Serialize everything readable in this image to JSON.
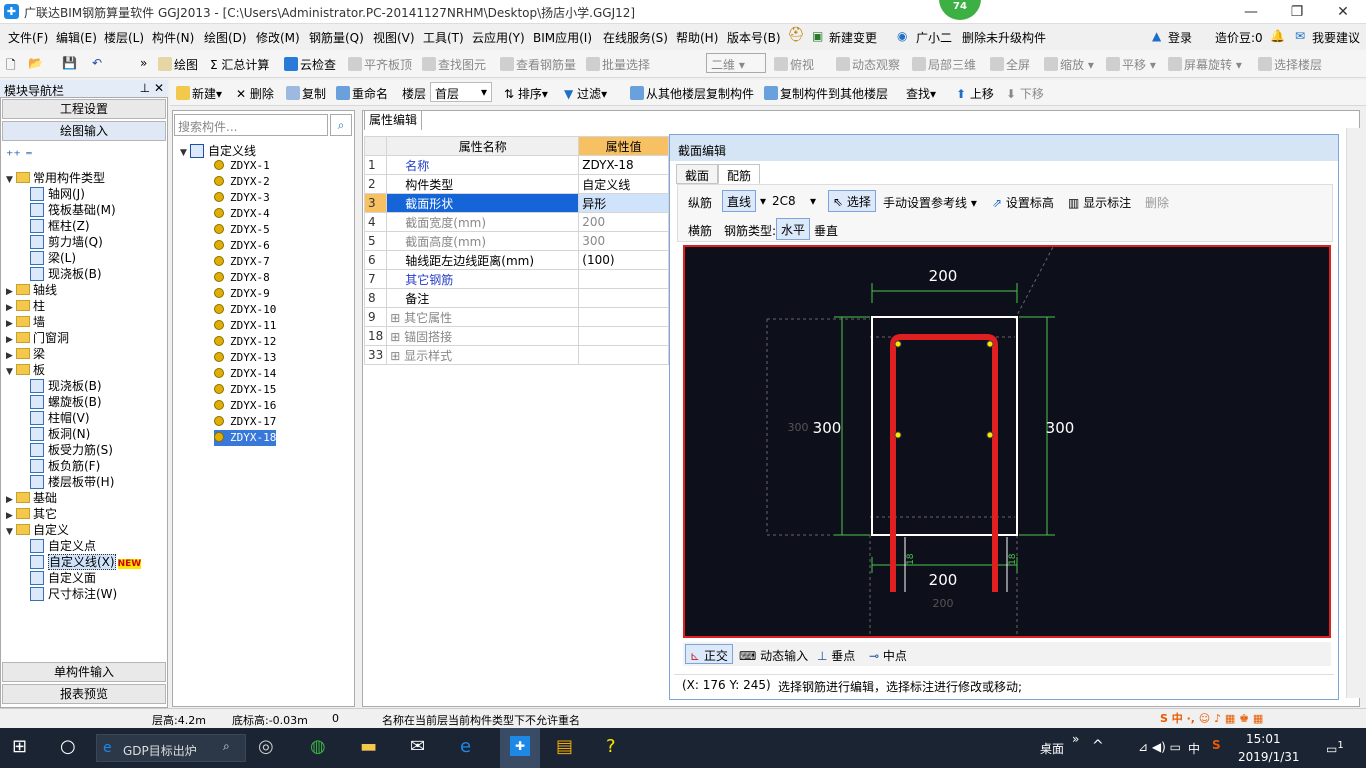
{
  "app": {
    "title": "广联达BIM钢筋算量软件 GGJ2013 - [C:\\Users\\Administrator.PC-20141127NRHM\\Desktop\\扬店小学.GGJ12]",
    "badge": "74",
    "win_min": "—",
    "win_max": "❐",
    "win_close": "✕"
  },
  "menu": [
    "文件(F)",
    "编辑(E)",
    "楼层(L)",
    "构件(N)",
    "绘图(D)",
    "修改(M)",
    "钢筋量(Q)",
    "视图(V)",
    "工具(T)",
    "云应用(Y)",
    "BIM应用(I)",
    "在线服务(S)",
    "帮助(H)",
    "版本号(B)",
    "新建变更",
    "广小二",
    "删除未升级构件"
  ],
  "menu_right": {
    "login": "登录",
    "price": "造价豆:0",
    "suggest": "我要建议"
  },
  "toolbar1": [
    "绘图",
    "Σ 汇总计算",
    "云检查",
    "平齐板顶",
    "查找图元",
    "查看钢筋量",
    "批量选择",
    "二维",
    "俯视",
    "动态观察",
    "局部三维",
    "全屏",
    "缩放",
    "平移",
    "屏幕旋转",
    "选择楼层"
  ],
  "toolbar2": [
    "新建",
    "删除",
    "复制",
    "重命名",
    "楼层",
    "首层",
    "排序",
    "过滤",
    "从其他楼层复制构件",
    "复制构件到其他楼层",
    "查找",
    "上移",
    "下移"
  ],
  "nav": {
    "title": "模块导航栏",
    "btn_project": "工程设置",
    "btn_draw": "绘图输入",
    "btn_single": "单构件输入",
    "btn_report": "报表预览",
    "tree": [
      {
        "label": "常用构件类型",
        "level": 0,
        "folder": true,
        "open": true
      },
      {
        "label": "轴网(J)",
        "level": 1
      },
      {
        "label": "筏板基础(M)",
        "level": 1
      },
      {
        "label": "框柱(Z)",
        "level": 1
      },
      {
        "label": "剪力墙(Q)",
        "level": 1
      },
      {
        "label": "梁(L)",
        "level": 1
      },
      {
        "label": "现浇板(B)",
        "level": 1
      },
      {
        "label": "轴线",
        "level": 0,
        "folder": true
      },
      {
        "label": "柱",
        "level": 0,
        "folder": true
      },
      {
        "label": "墙",
        "level": 0,
        "folder": true
      },
      {
        "label": "门窗洞",
        "level": 0,
        "folder": true
      },
      {
        "label": "梁",
        "level": 0,
        "folder": true
      },
      {
        "label": "板",
        "level": 0,
        "folder": true,
        "open": true
      },
      {
        "label": "现浇板(B)",
        "level": 1
      },
      {
        "label": "螺旋板(B)",
        "level": 1
      },
      {
        "label": "柱帽(V)",
        "level": 1
      },
      {
        "label": "板洞(N)",
        "level": 1
      },
      {
        "label": "板受力筋(S)",
        "level": 1
      },
      {
        "label": "板负筋(F)",
        "level": 1
      },
      {
        "label": "楼层板带(H)",
        "level": 1
      },
      {
        "label": "基础",
        "level": 0,
        "folder": true
      },
      {
        "label": "其它",
        "level": 0,
        "folder": true
      },
      {
        "label": "自定义",
        "level": 0,
        "folder": true,
        "open": true
      },
      {
        "label": "自定义点",
        "level": 1
      },
      {
        "label": "自定义线(X)",
        "level": 1,
        "selected": true
      },
      {
        "label": "自定义面",
        "level": 1
      },
      {
        "label": "尺寸标注(W)",
        "level": 1
      }
    ],
    "new_tag": "NEW"
  },
  "list": {
    "search_placeholder": "搜索构件...",
    "root": "自定义线",
    "items": [
      "ZDYX-1",
      "ZDYX-2",
      "ZDYX-3",
      "ZDYX-4",
      "ZDYX-5",
      "ZDYX-6",
      "ZDYX-7",
      "ZDYX-8",
      "ZDYX-9",
      "ZDYX-10",
      "ZDYX-11",
      "ZDYX-12",
      "ZDYX-13",
      "ZDYX-14",
      "ZDYX-15",
      "ZDYX-16",
      "ZDYX-17",
      "ZDYX-18"
    ]
  },
  "props": {
    "tab": "属性编辑",
    "col_name": "属性名称",
    "col_value": "属性值",
    "rows": [
      {
        "n": "1",
        "k": "名称",
        "v": "ZDYX-18",
        "style": "blue"
      },
      {
        "n": "2",
        "k": "构件类型",
        "v": "自定义线",
        "style": ""
      },
      {
        "n": "3",
        "k": "截面形状",
        "v": "异形",
        "style": "sel"
      },
      {
        "n": "4",
        "k": "截面宽度(mm)",
        "v": "200",
        "style": "gray"
      },
      {
        "n": "5",
        "k": "截面高度(mm)",
        "v": "300",
        "style": "gray"
      },
      {
        "n": "6",
        "k": "轴线距左边线距离(mm)",
        "v": "(100)",
        "style": ""
      },
      {
        "n": "7",
        "k": "其它钢筋",
        "v": "",
        "style": "blue"
      },
      {
        "n": "8",
        "k": "备注",
        "v": "",
        "style": ""
      },
      {
        "n": "9",
        "k": "其它属性",
        "v": "",
        "style": "group"
      },
      {
        "n": "18",
        "k": "锚固搭接",
        "v": "",
        "style": "group"
      },
      {
        "n": "33",
        "k": "显示样式",
        "v": "",
        "style": "group"
      }
    ]
  },
  "dialog": {
    "title": "截面编辑",
    "tab_section": "截面",
    "tab_rebar": "配筋",
    "tb_long": "纵筋",
    "tb_line": "直线",
    "tb_spec": "2C8",
    "tb_select": "选择",
    "tb_manual": "手动设置参考线",
    "tb_setelev": "设置标高",
    "tb_showdim": "显示标注",
    "tb_delete": "删除",
    "tb_trans": "横筋",
    "tb_type_label": "钢筋类型:",
    "tb_horizontal": "水平",
    "tb_vertical": "垂直",
    "dim_top": "200",
    "dim_left": "300",
    "dim_left_small": "300",
    "dim_right": "300",
    "dim_bottom": "200",
    "dim_bottom_small": "200",
    "dim_18a": "18",
    "dim_18b": "18",
    "bottom_ortho": "正交",
    "bottom_dynamic": "动态输入",
    "bottom_perp": "垂点",
    "bottom_mid": "中点",
    "coords": "(X: 176 Y: 245)",
    "hint": "选择钢筋进行编辑，选择标注进行修改或移动;"
  },
  "status": {
    "floor_height": "层高:4.2m",
    "base_elev": "底标高:-0.03m",
    "zero": "0",
    "message": "名称在当前层当前构件类型下不允许重名"
  },
  "taskbar": {
    "search_text": "GDP目标出炉",
    "desktop": "桌面",
    "ime": "中",
    "time": "15:01",
    "date": "2019/1/31",
    "notif": "1"
  },
  "colors": {
    "accent": "#1565d8",
    "rebar": "#e02020",
    "canvas": "#0d0f1a",
    "dim": "#4ec44e"
  }
}
